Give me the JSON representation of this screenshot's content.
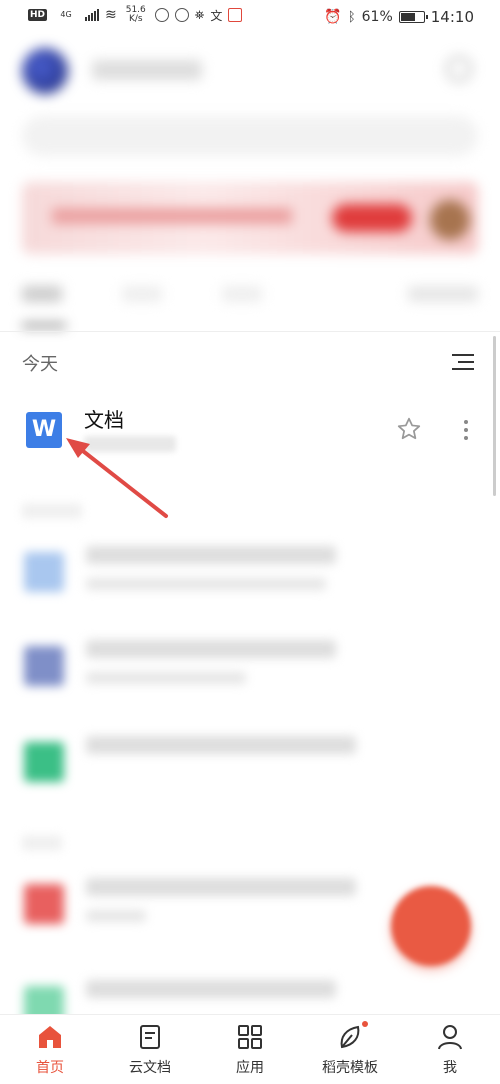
{
  "status_bar": {
    "hd": "HD",
    "network": "4G",
    "speed_value": "51.6",
    "speed_unit": "K/s",
    "battery": "61%",
    "time": "14:10"
  },
  "header": {
    "icon_right": "settings-icon"
  },
  "recent": {
    "section_label": "今天",
    "document": {
      "name": "文档",
      "icon_letter": "W"
    }
  },
  "colors": {
    "accent": "#e8533c",
    "wps_blue": "#3d7ee6",
    "fab": "#e95a43"
  },
  "nav": {
    "items": [
      {
        "label": "首页",
        "icon": "home-icon"
      },
      {
        "label": "云文档",
        "icon": "cloud-doc-icon"
      },
      {
        "label": "应用",
        "icon": "apps-grid-icon"
      },
      {
        "label": "稻壳模板",
        "icon": "leaf-icon"
      },
      {
        "label": "我",
        "icon": "profile-icon"
      }
    ]
  }
}
